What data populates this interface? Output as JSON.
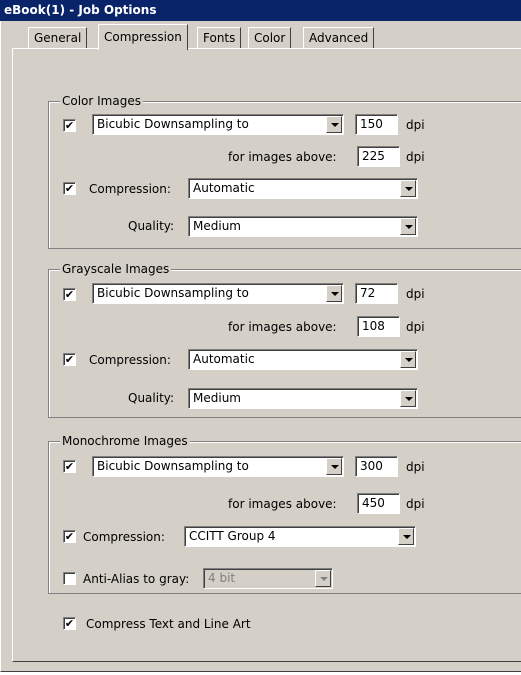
{
  "window": {
    "title": "eBook(1) - Job Options"
  },
  "tabs": [
    {
      "label": "General",
      "active": false
    },
    {
      "label": "Compression",
      "active": true
    },
    {
      "label": "Fonts",
      "active": false
    },
    {
      "label": "Color",
      "active": false
    },
    {
      "label": "Advanced",
      "active": false
    }
  ],
  "color_images": {
    "legend": "Color Images",
    "downsample_checked": true,
    "downsample_method": "Bicubic Downsampling to",
    "resolution": "150",
    "resolution_unit": "dpi",
    "above_label": "for images above:",
    "above_value": "225",
    "above_unit": "dpi",
    "compression_checked": true,
    "compression_label": "Compression:",
    "compression_value": "Automatic",
    "quality_label": "Quality:",
    "quality_value": "Medium"
  },
  "grayscale_images": {
    "legend": "Grayscale Images",
    "downsample_checked": true,
    "downsample_method": "Bicubic Downsampling to",
    "resolution": "72",
    "resolution_unit": "dpi",
    "above_label": "for images above:",
    "above_value": "108",
    "above_unit": "dpi",
    "compression_checked": true,
    "compression_label": "Compression:",
    "compression_value": "Automatic",
    "quality_label": "Quality:",
    "quality_value": "Medium"
  },
  "monochrome_images": {
    "legend": "Monochrome Images",
    "downsample_checked": true,
    "downsample_method": "Bicubic Downsampling to",
    "resolution": "300",
    "resolution_unit": "dpi",
    "above_label": "for images above:",
    "above_value": "450",
    "above_unit": "dpi",
    "compression_checked": true,
    "compression_label": "Compression:",
    "compression_value": "CCITT Group 4",
    "antialias_checked": false,
    "antialias_label": "Anti-Alias to gray:",
    "antialias_value": "4 bit"
  },
  "compress_text": {
    "checked": true,
    "label": "Compress Text and Line Art"
  },
  "check_glyph": "✔"
}
